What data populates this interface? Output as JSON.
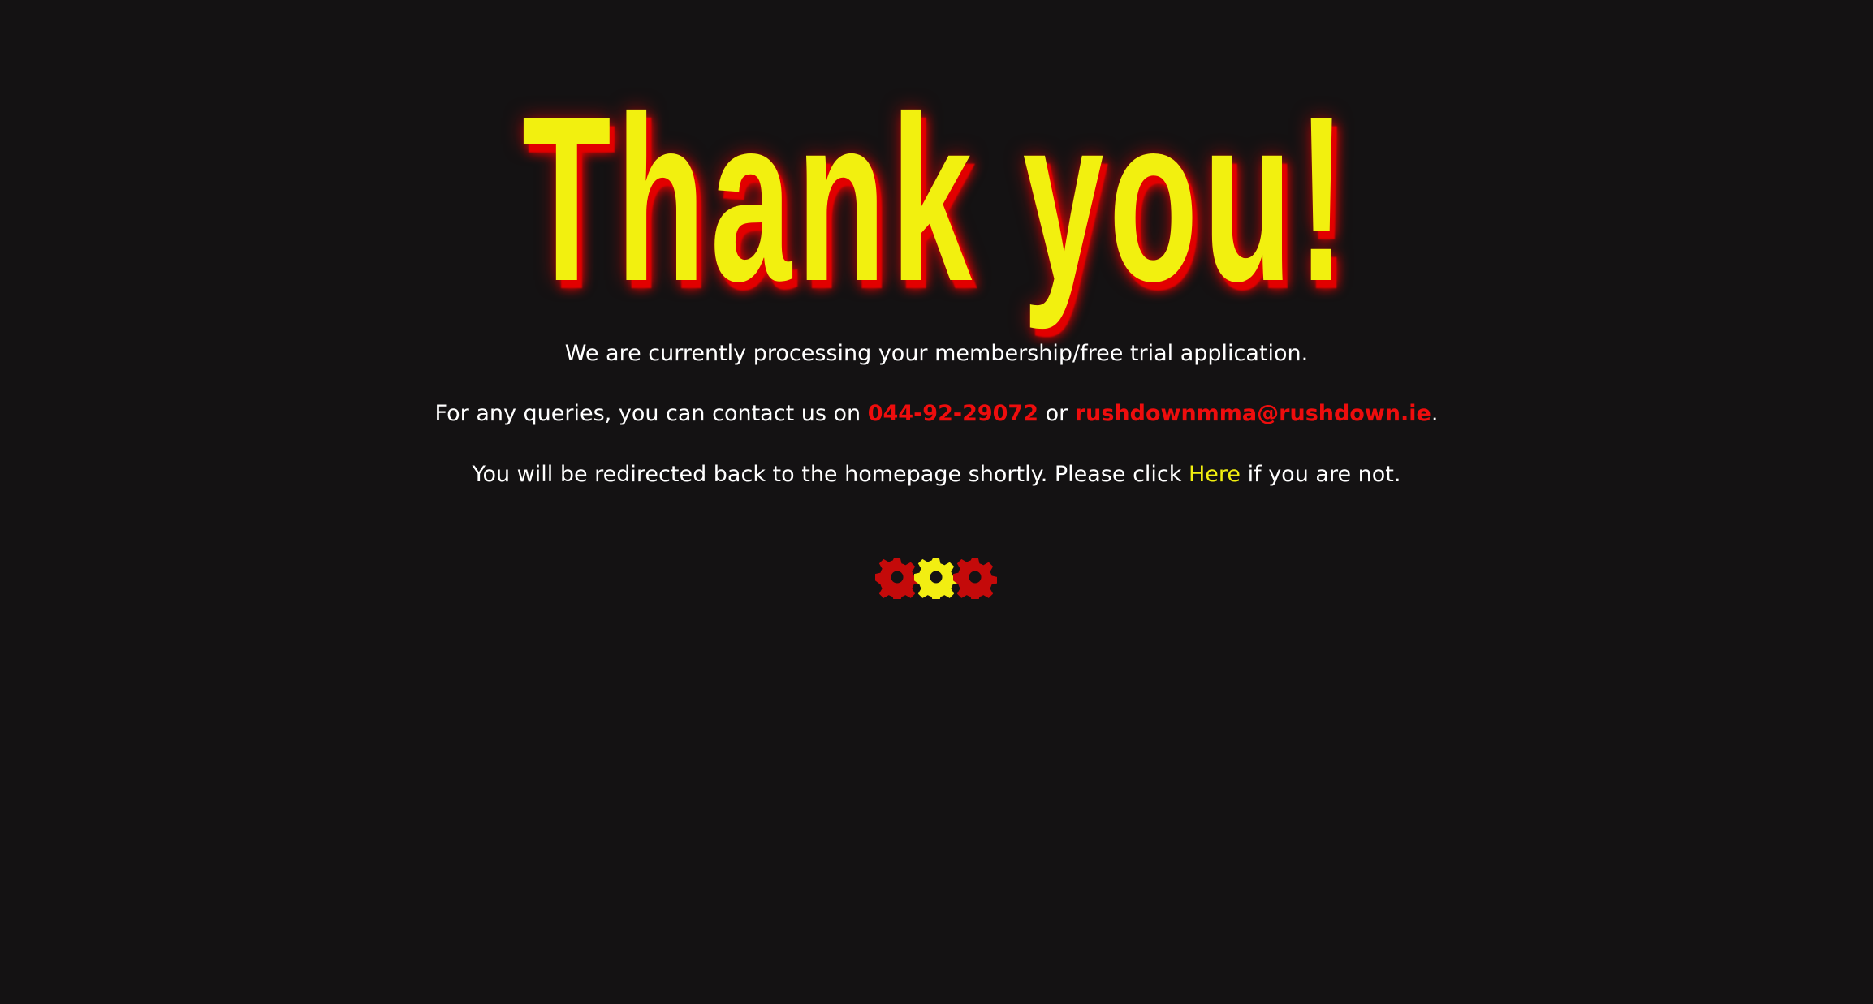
{
  "title": "Thank you!",
  "message_processing": "We are currently processing your membership/free trial application.",
  "contact": {
    "prefix": "For any queries, you can contact us on ",
    "phone": "044-92-29072",
    "connector": " or ",
    "email": "rushdownmma@rushdown.ie",
    "suffix": "."
  },
  "redirect": {
    "prefix": "You will be redirected back to the homepage shortly. Please click ",
    "link_label": "Here",
    "suffix": " if you are not."
  },
  "loader": {
    "icons": [
      "gear-icon",
      "gear-icon",
      "gear-icon"
    ],
    "colors": [
      "#c40a0a",
      "#f2ee12",
      "#c40a0a"
    ]
  },
  "colors": {
    "background": "#141213",
    "title_fill": "#f2f00f",
    "title_glow": "#e20000",
    "link_red": "#ee0d0d",
    "link_yellow": "#f2f00f"
  }
}
